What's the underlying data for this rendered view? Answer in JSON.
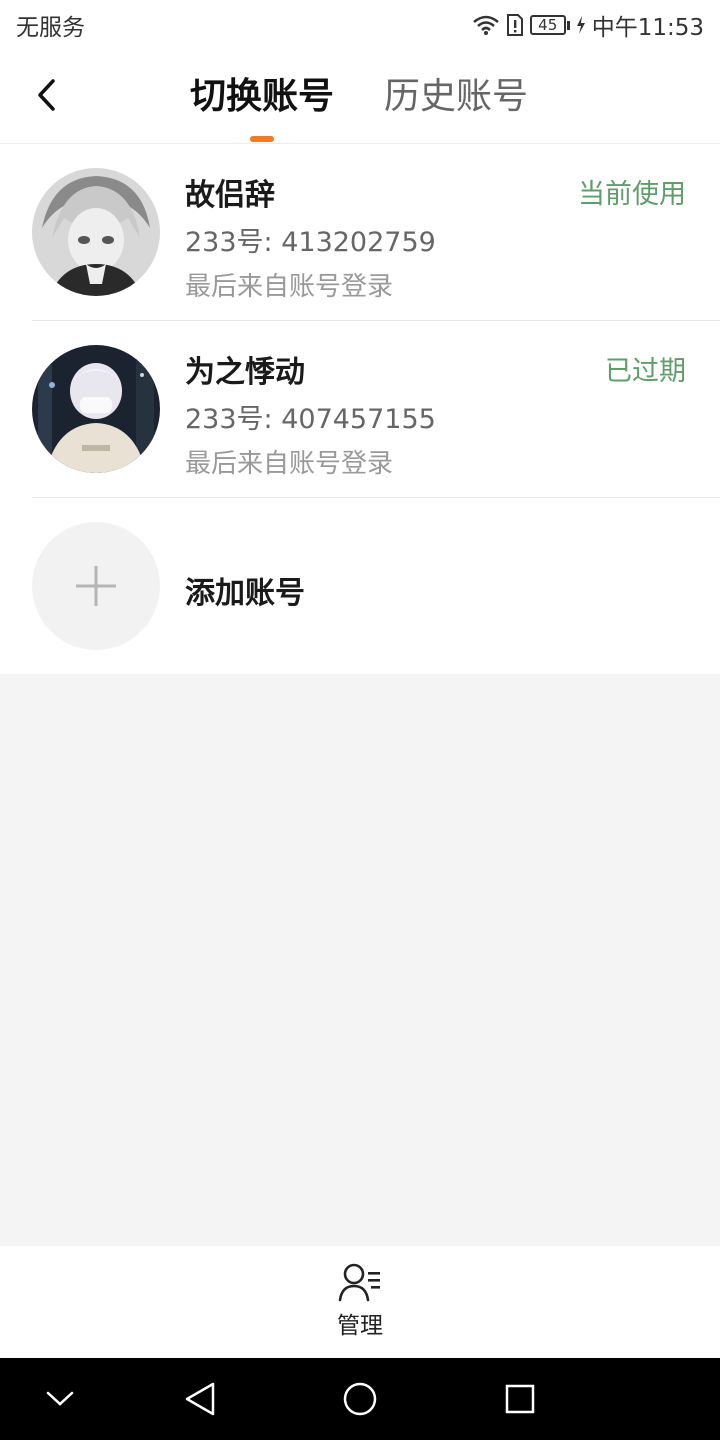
{
  "status_bar": {
    "carrier": "无服务",
    "battery": "45",
    "time": "中午11:53"
  },
  "header": {
    "tabs": [
      {
        "label": "切换账号",
        "active": true
      },
      {
        "label": "历史账号",
        "active": false
      }
    ],
    "accent_color": "#f07b22"
  },
  "accounts": [
    {
      "name": "故侣辞",
      "uid": "233号: 413202759",
      "source": "最后来自账号登录",
      "status": "当前使用"
    },
    {
      "name": "为之悸动",
      "uid": "233号: 407457155",
      "source": "最后来自账号登录",
      "status": "已过期"
    }
  ],
  "add_account": {
    "label": "添加账号",
    "icon": "plus-icon"
  },
  "bottom_bar": {
    "manage_label": "管理",
    "manage_icon": "user-list-icon"
  },
  "status_color": "#5f9e6a"
}
